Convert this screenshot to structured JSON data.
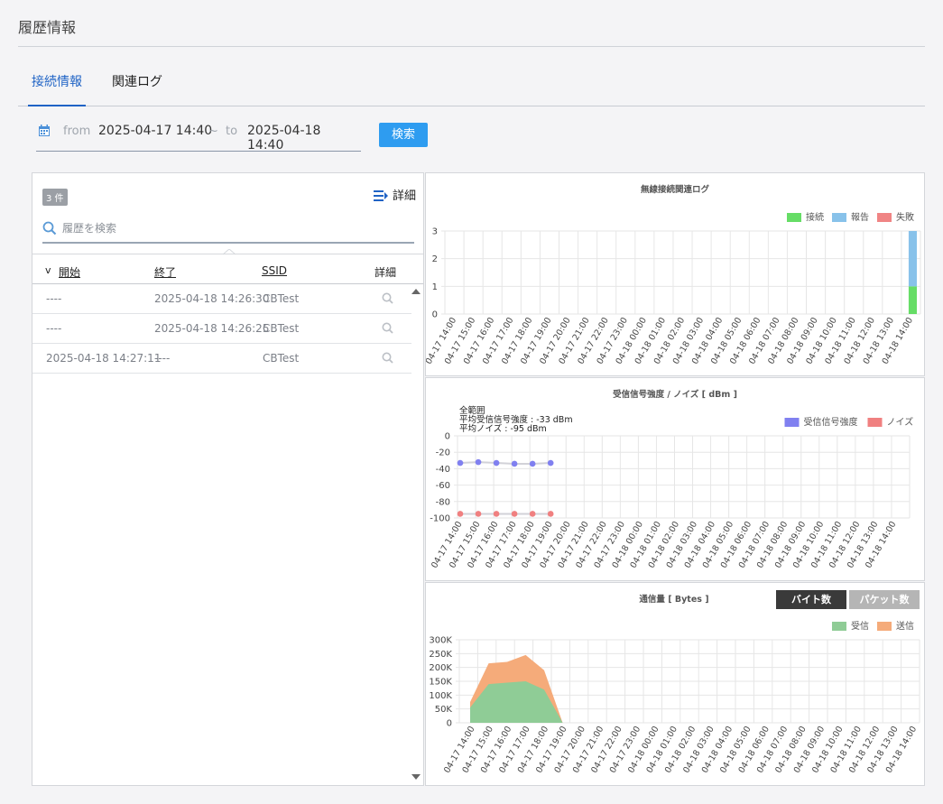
{
  "page": {
    "title": "履歴情報"
  },
  "tabs": [
    {
      "label": "接続情報",
      "active": true
    },
    {
      "label": "関連ログ",
      "active": false
    }
  ],
  "date_range": {
    "from_label": "from",
    "from_value": "2025-04-17 14:40",
    "separator": "~",
    "to_label": "to",
    "to_value": "2025-04-18 14:40"
  },
  "search_button": "検索",
  "history": {
    "count": "3 件",
    "detail_link": "詳細",
    "search_placeholder": "履歴を検索",
    "columns": {
      "sort_mark": "v",
      "start": "開始",
      "end": "終了",
      "ssid": "SSID",
      "detail": "詳細"
    },
    "rows": [
      {
        "start": "----",
        "end": "2025-04-18 14:26:30",
        "ssid": "CBTest"
      },
      {
        "start": "----",
        "end": "2025-04-18 14:26:25",
        "ssid": "CBTest"
      },
      {
        "start": "2025-04-18 14:27:11",
        "end": "----",
        "ssid": "CBTest"
      }
    ]
  },
  "colors": {
    "accent": "#1f63c5",
    "button": "#2e9cf0",
    "connect": "#66dd66",
    "report": "#88c2ea",
    "fail": "#f08484",
    "rssi": "#8080f0",
    "noise": "#f08080",
    "recv": "#8fcc96",
    "send": "#f5ab7a"
  },
  "time_labels": [
    "04-17 14:00",
    "04-17 15:00",
    "04-17 16:00",
    "04-17 17:00",
    "04-17 18:00",
    "04-17 19:00",
    "04-17 20:00",
    "04-17 21:00",
    "04-17 22:00",
    "04-17 23:00",
    "04-18 00:00",
    "04-18 01:00",
    "04-18 02:00",
    "04-18 03:00",
    "04-18 04:00",
    "04-18 05:00",
    "04-18 06:00",
    "04-18 07:00",
    "04-18 08:00",
    "04-18 09:00",
    "04-18 10:00",
    "04-18 11:00",
    "04-18 12:00",
    "04-18 13:00",
    "04-18 14:00"
  ],
  "chart_data": [
    {
      "type": "bar",
      "title": "無線接続関連ログ",
      "categories": [
        "04-17 14:00",
        "04-17 15:00",
        "04-17 16:00",
        "04-17 17:00",
        "04-17 18:00",
        "04-17 19:00",
        "04-17 20:00",
        "04-17 21:00",
        "04-17 22:00",
        "04-17 23:00",
        "04-18 00:00",
        "04-18 01:00",
        "04-18 02:00",
        "04-18 03:00",
        "04-18 04:00",
        "04-18 05:00",
        "04-18 06:00",
        "04-18 07:00",
        "04-18 08:00",
        "04-18 09:00",
        "04-18 10:00",
        "04-18 11:00",
        "04-18 12:00",
        "04-18 13:00",
        "04-18 14:00"
      ],
      "stacked": true,
      "series": [
        {
          "name": "接続",
          "values": [
            0,
            0,
            0,
            0,
            0,
            0,
            0,
            0,
            0,
            0,
            0,
            0,
            0,
            0,
            0,
            0,
            0,
            0,
            0,
            0,
            0,
            0,
            0,
            0,
            1
          ]
        },
        {
          "name": "報告",
          "values": [
            0,
            0,
            0,
            0,
            0,
            0,
            0,
            0,
            0,
            0,
            0,
            0,
            0,
            0,
            0,
            0,
            0,
            0,
            0,
            0,
            0,
            0,
            0,
            0,
            2
          ]
        },
        {
          "name": "失敗",
          "values": [
            0,
            0,
            0,
            0,
            0,
            0,
            0,
            0,
            0,
            0,
            0,
            0,
            0,
            0,
            0,
            0,
            0,
            0,
            0,
            0,
            0,
            0,
            0,
            0,
            0
          ]
        }
      ],
      "ylim": [
        0,
        3
      ],
      "yticks": [
        0,
        1,
        2,
        3
      ],
      "grid": true,
      "legend": "top-right"
    },
    {
      "type": "line",
      "title": "受信信号強度 / ノイズ [ dBm ]",
      "annotations": [
        "全範囲",
        "平均受信信号強度 : -33 dBm",
        "平均ノイズ : -95 dBm"
      ],
      "categories": [
        "04-17 14:00",
        "04-17 15:00",
        "04-17 16:00",
        "04-17 17:00",
        "04-17 18:00",
        "04-17 19:00",
        "04-17 20:00",
        "04-17 21:00",
        "04-17 22:00",
        "04-17 23:00",
        "04-18 00:00",
        "04-18 01:00",
        "04-18 02:00",
        "04-18 03:00",
        "04-18 04:00",
        "04-18 05:00",
        "04-18 06:00",
        "04-18 07:00",
        "04-18 08:00",
        "04-18 09:00",
        "04-18 10:00",
        "04-18 11:00",
        "04-18 12:00",
        "04-18 13:00",
        "04-18 14:00"
      ],
      "series": [
        {
          "name": "受信信号強度",
          "values": [
            -33,
            -32,
            -33,
            -34,
            -34,
            -33,
            null,
            null,
            null,
            null,
            null,
            null,
            null,
            null,
            null,
            null,
            null,
            null,
            null,
            null,
            null,
            null,
            null,
            null,
            null
          ]
        },
        {
          "name": "ノイズ",
          "values": [
            -95,
            -95,
            -95,
            -95,
            -95,
            -95,
            null,
            null,
            null,
            null,
            null,
            null,
            null,
            null,
            null,
            null,
            null,
            null,
            null,
            null,
            null,
            null,
            null,
            null,
            null
          ]
        }
      ],
      "ylim": [
        -100,
        0
      ],
      "yticks": [
        0,
        -20,
        -40,
        -60,
        -80,
        -100
      ],
      "grid": true,
      "legend": "top-right"
    },
    {
      "type": "area",
      "title": "通信量 [ Bytes ]",
      "buttons": [
        "バイト数",
        "パケット数"
      ],
      "categories": [
        "04-17 14:00",
        "04-17 15:00",
        "04-17 16:00",
        "04-17 17:00",
        "04-17 18:00",
        "04-17 19:00",
        "04-17 20:00",
        "04-17 21:00",
        "04-17 22:00",
        "04-17 23:00",
        "04-18 00:00",
        "04-18 01:00",
        "04-18 02:00",
        "04-18 03:00",
        "04-18 04:00",
        "04-18 05:00",
        "04-18 06:00",
        "04-18 07:00",
        "04-18 08:00",
        "04-18 09:00",
        "04-18 10:00",
        "04-18 11:00",
        "04-18 12:00",
        "04-18 13:00",
        "04-18 14:00"
      ],
      "stacked": true,
      "series": [
        {
          "name": "受信",
          "values": [
            55000,
            140000,
            145000,
            150000,
            120000,
            0,
            null,
            null,
            null,
            null,
            null,
            null,
            null,
            null,
            null,
            null,
            null,
            null,
            null,
            null,
            null,
            null,
            null,
            null,
            null
          ]
        },
        {
          "name": "送信",
          "values": [
            20000,
            75000,
            75000,
            95000,
            70000,
            0,
            null,
            null,
            null,
            null,
            null,
            null,
            null,
            null,
            null,
            null,
            null,
            null,
            null,
            null,
            null,
            null,
            null,
            null,
            null
          ]
        }
      ],
      "ylim": [
        0,
        300000
      ],
      "ytick_labels": [
        "0",
        "50K",
        "100K",
        "150K",
        "200K",
        "250K",
        "300K"
      ],
      "grid": true,
      "legend": "top-right"
    }
  ]
}
